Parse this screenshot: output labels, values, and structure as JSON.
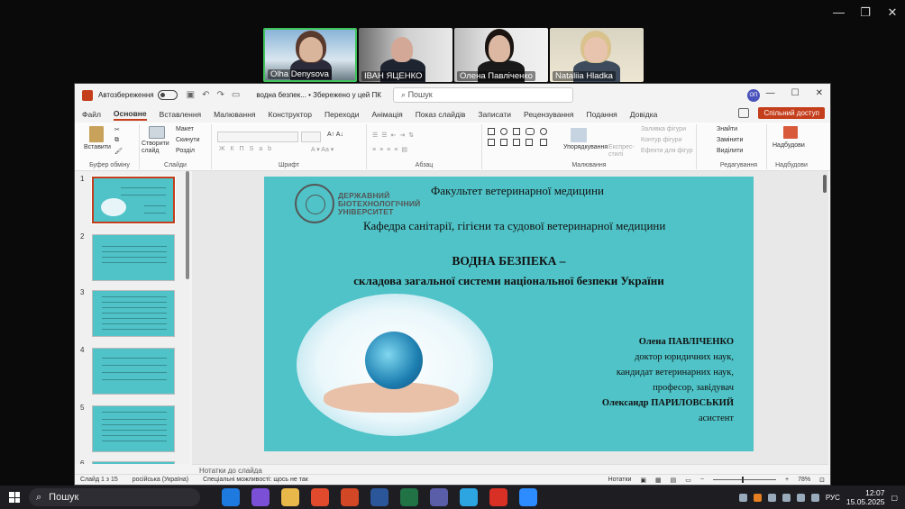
{
  "zoom": {
    "participants": [
      {
        "name": "Olha Denysova"
      },
      {
        "name": "ІВАН ЯЦЕНКО"
      },
      {
        "name": "Олена Павліченко"
      },
      {
        "name": "Nataliia Hladka"
      }
    ],
    "controls": [
      "minimize-icon",
      "restore-icon",
      "close-icon"
    ]
  },
  "ppt": {
    "autosave_label": "Автозбереження",
    "doc_title": "водна безпек... • Збережено у цей ПК",
    "search_placeholder": "Пошук",
    "avatar": "ОП",
    "tabs": [
      "Файл",
      "Основне",
      "Вставлення",
      "Малювання",
      "Конструктор",
      "Переходи",
      "Анімація",
      "Показ слайдів",
      "Записати",
      "Рецензування",
      "Подання",
      "Довідка"
    ],
    "share_label": "Спільний доступ",
    "ribbon": {
      "paste": "Вставити",
      "clipboard": "Буфер обміну",
      "new_slide": "Створити слайд",
      "layout": "Макет",
      "reset": "Скинути",
      "section": "Розділ",
      "slides_group": "Слайди",
      "font_group": "Шрифт",
      "paragraph_group": "Абзац",
      "drawing_group": "Малювання",
      "arrange": "Упорядкування",
      "quick_styles": "Експрес-стилі",
      "shape_fill": "Заливка фігури",
      "shape_outline": "Контур фігури",
      "shape_effects": "Ефекти для фігур",
      "find": "Знайти",
      "replace": "Замінити",
      "select": "Виділити",
      "editing_group": "Редагування",
      "designer": "Надбудови",
      "addins_group": "Надбудови"
    },
    "thumbs": [
      "1",
      "2",
      "3",
      "4",
      "5",
      "6"
    ],
    "notes_label": "Нотатки до слайда",
    "status": {
      "slide": "Слайд 1 з 15",
      "lang": "російська (Україна)",
      "accessibility": "Спеціальні можливості: щось не так",
      "notes": "Нотатки",
      "zoom": "78%"
    }
  },
  "slide": {
    "university": [
      "ДЕРЖАВНИЙ",
      "БІОТЕХНОЛОГІЧНИЙ",
      "УНІВЕРСИТЕТ"
    ],
    "faculty": "Факультет ветеринарної медицини",
    "department": "Кафедра санітарії, гігієни та судової ветеринарної медицини",
    "title1": "ВОДНА БЕЗПЕКА –",
    "title2": "складова загальної системи національної безпеки України",
    "authors": [
      {
        "text": "Олена ПАВЛІЧЕНКО",
        "bold": true
      },
      {
        "text": "доктор юридичних наук,",
        "bold": false
      },
      {
        "text": "кандидат ветеринарних наук,",
        "bold": false
      },
      {
        "text": "професор, завідувач",
        "bold": false
      },
      {
        "text": "Олександр ПАРИЛОВСЬКИЙ",
        "bold": true
      },
      {
        "text": "асистент",
        "bold": false
      }
    ]
  },
  "taskbar": {
    "search_label": "Пошук",
    "lang": "РУС",
    "time": "12:07",
    "date": "15.05.2025",
    "app_colors": [
      "#1f7ae0",
      "#7b4fd6",
      "#e8b84a",
      "#e24a2d",
      "#d24726",
      "#2b579a",
      "#217346",
      "#5a5ea8",
      "#2ca5e0",
      "#d93025",
      "#2d8cff"
    ]
  }
}
